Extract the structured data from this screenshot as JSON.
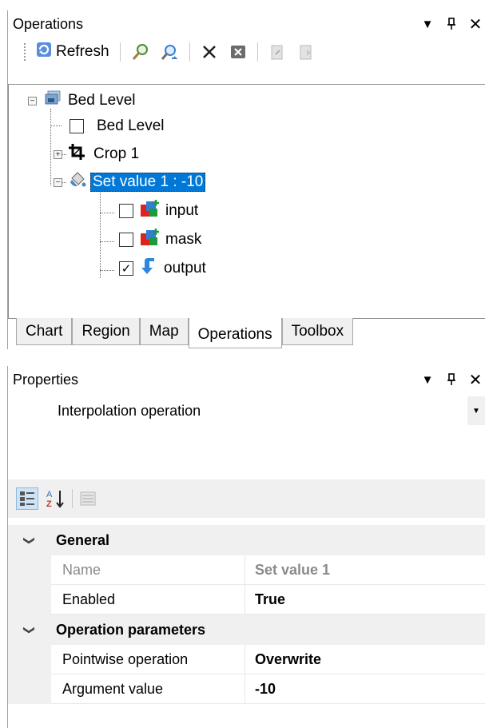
{
  "operations_panel": {
    "title": "Operations",
    "toolbar": {
      "refresh_label": "Refresh",
      "icons": [
        "zoom-to-icon",
        "search-icon",
        "delete-icon",
        "close-box-icon",
        "export-icon",
        "import-icon"
      ]
    },
    "tree": {
      "root": {
        "label": "Bed Level",
        "expanded": true
      },
      "items": [
        {
          "label": "Bed Level",
          "checked": false
        },
        {
          "label": "Crop 1",
          "expanded": false
        },
        {
          "label": "Set value 1 : -10",
          "expanded": true,
          "selected": true
        }
      ],
      "children": [
        {
          "label": "input",
          "checked": false
        },
        {
          "label": "mask",
          "checked": false
        },
        {
          "label": "output",
          "checked": true
        }
      ]
    },
    "tabs": [
      "Chart",
      "Region",
      "Map",
      "Operations",
      "Toolbox"
    ],
    "active_tab": "Operations"
  },
  "properties_panel": {
    "title": "Properties",
    "object_selector": "Interpolation operation",
    "categories": [
      {
        "name": "General",
        "rows": [
          {
            "name": "Name",
            "value": "Set value 1",
            "readonly": true
          },
          {
            "name": "Enabled",
            "value": "True"
          }
        ]
      },
      {
        "name": "Operation parameters",
        "rows": [
          {
            "name": "Pointwise operation",
            "value": "Overwrite"
          },
          {
            "name": "Argument value",
            "value": "-10"
          }
        ]
      }
    ]
  },
  "colors": {
    "selection": "#0078d7",
    "panel_bg": "#f0f0f0",
    "border": "#a0a0a0"
  }
}
